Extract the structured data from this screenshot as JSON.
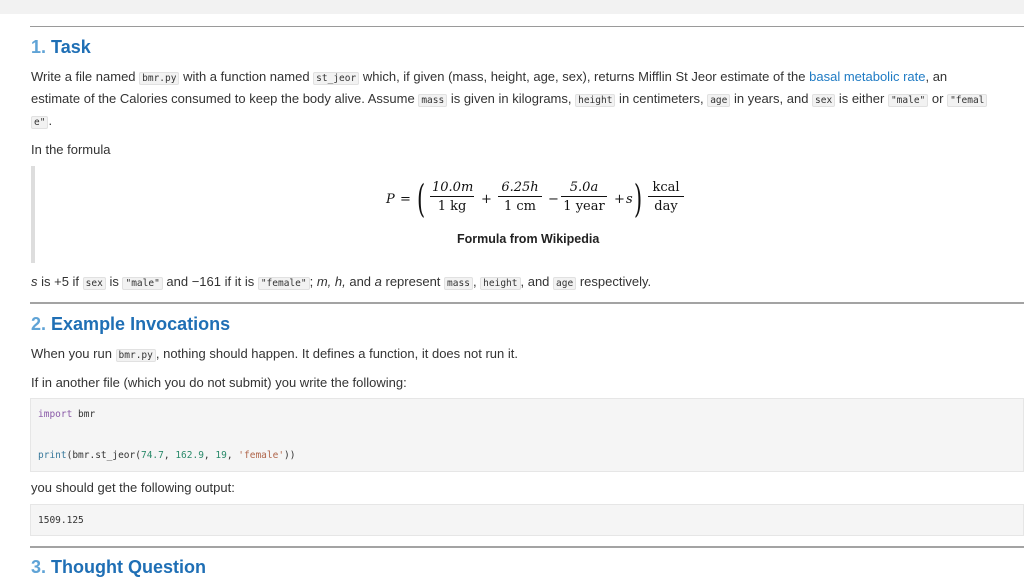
{
  "task": {
    "number": "1.",
    "title": "Task",
    "p1": {
      "t1": "Write a file named ",
      "c1": "bmr.py",
      "t2": " with a function named ",
      "c2": "st_jeor",
      "t3": " which, if given (mass, height, age, sex), returns Mifflin St Jeor estimate of the ",
      "link": "basal metabolic rate",
      "t4": ", an",
      "line2_t1": "estimate of the Calories consumed to keep the body alive. Assume ",
      "c3": "mass",
      "t5": " is given in kilograms, ",
      "c4": "height",
      "t6": " in centimeters, ",
      "c5": "age",
      "t7": " in years, and ",
      "c6": "sex",
      "t8": " is either ",
      "c7": "\"male\"",
      "t9": " or ",
      "c8a": "\"femal",
      "c8b": "e\"",
      "t10": "."
    },
    "in_formula": "In the formula",
    "formula": {
      "lhs": "P",
      "eq": "=",
      "f1_num": "10.0m",
      "f1_den": "1 kg",
      "plus1": "+",
      "f2_num": "6.25h",
      "f2_den": "1 cm",
      "minus": "−",
      "f3_num": "5.0a",
      "f3_den": "1 year",
      "plus2": "+",
      "s": "s",
      "f4_num": "kcal",
      "f4_den": "day"
    },
    "caption": "Formula from Wikipedia",
    "p2": {
      "s": "s",
      "t1": " is +5 if ",
      "c1": "sex",
      "t2": " is ",
      "c2": "\"male\"",
      "t3": " and −161 if it is ",
      "c3": "\"female\"",
      "t4": "; ",
      "m": "m, h,",
      "t5": " and ",
      "a": "a",
      "t6": " represent ",
      "c4": "mass",
      "t7": ", ",
      "c5": "height",
      "t8": ", and ",
      "c6": "age",
      "t9": " respectively."
    }
  },
  "examples": {
    "number": "2.",
    "title": "Example Invocations",
    "p1_t1": "When you run ",
    "p1_c1": "bmr.py",
    "p1_t2": ", nothing should happen. It defines a function, it does not run it.",
    "p2": "If in another file (which you do not submit) you write the following:",
    "code": {
      "kw_import": "import",
      "mod": " bmr",
      "fn_print": "print",
      "call_open": "(bmr.st_jeor(",
      "n1": "74.7",
      "sep1": ", ",
      "n2": "162.9",
      "sep2": ", ",
      "n3": "19",
      "sep3": ", ",
      "s1": "'female'",
      "close": "))"
    },
    "p3": "you should get the following output:",
    "output": "1509.125"
  },
  "thought": {
    "number": "3.",
    "title": "Thought Question"
  },
  "colors": {
    "heading": "#1f6fb5",
    "link": "#1f7bc4"
  }
}
